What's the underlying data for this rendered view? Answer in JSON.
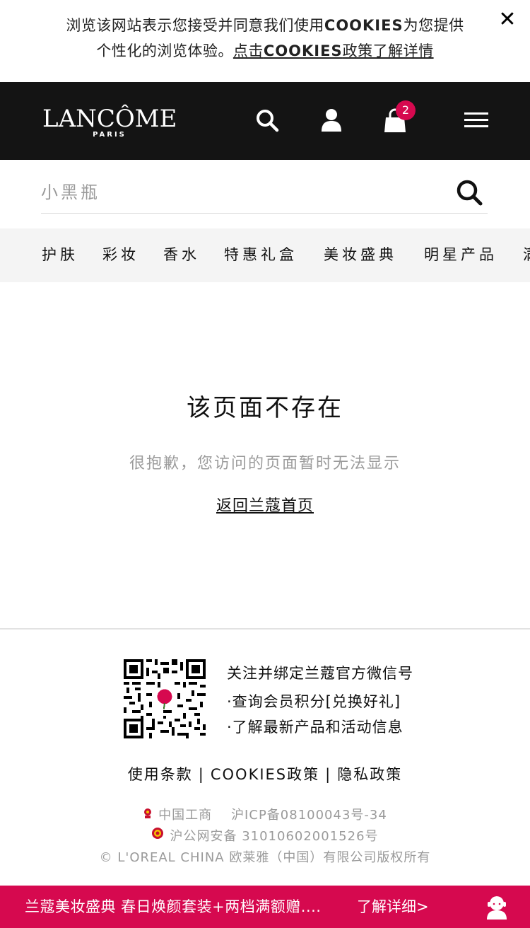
{
  "cookie_banner": {
    "line1_pre": "浏览该网站表示您接受并同意我们使用",
    "line1_kw": "COOKIES",
    "line1_post": "为您提供",
    "line2_pre": "个性化的浏览体验。",
    "link_pre": "点击",
    "link_kw": "COOKIES",
    "link_post": "政策了解详情",
    "close_icon": "close-icon"
  },
  "header": {
    "logo_main": "LANCÔME",
    "logo_sub": "PARIS",
    "icons": [
      "search-icon",
      "account-icon",
      "cart-icon",
      "menu-icon"
    ],
    "cart_count": "2",
    "bg_color": "#141414",
    "badge_color": "#d6094f"
  },
  "search": {
    "placeholder": "小黑瓶",
    "button_icon": "search-icon"
  },
  "categories": [
    "护肤",
    "彩妆",
    "香水",
    "特惠礼盒",
    "美妆盛典",
    "明星产品",
    "满"
  ],
  "main": {
    "title": "该页面不存在",
    "subtitle": "很抱歉，您访问的页面暂时无法显示",
    "home_link": "返回兰蔻首页"
  },
  "footer": {
    "wechat_title": "关注并绑定兰蔻官方微信号",
    "wechat_lines": [
      "·查询会员积分[兑换好礼]",
      "·了解最新产品和活动信息"
    ],
    "links": [
      "使用条款",
      "COOKIES政策",
      "隐私政策"
    ],
    "separator": "|",
    "legal_1a": "中国工商",
    "legal_1b": "沪ICP备08100043号-34",
    "legal_2": "沪公网安备 31010602001526号",
    "copyright": "© L'OREAL CHINA 欧莱雅（中国）有限公司版权所有"
  },
  "promo": {
    "text": "兰蔻美妆盛典 春日焕颜套装+两档满额赠....",
    "more": "了解详细>",
    "icon": "customer-service-icon",
    "bg_color": "#d6094f"
  }
}
